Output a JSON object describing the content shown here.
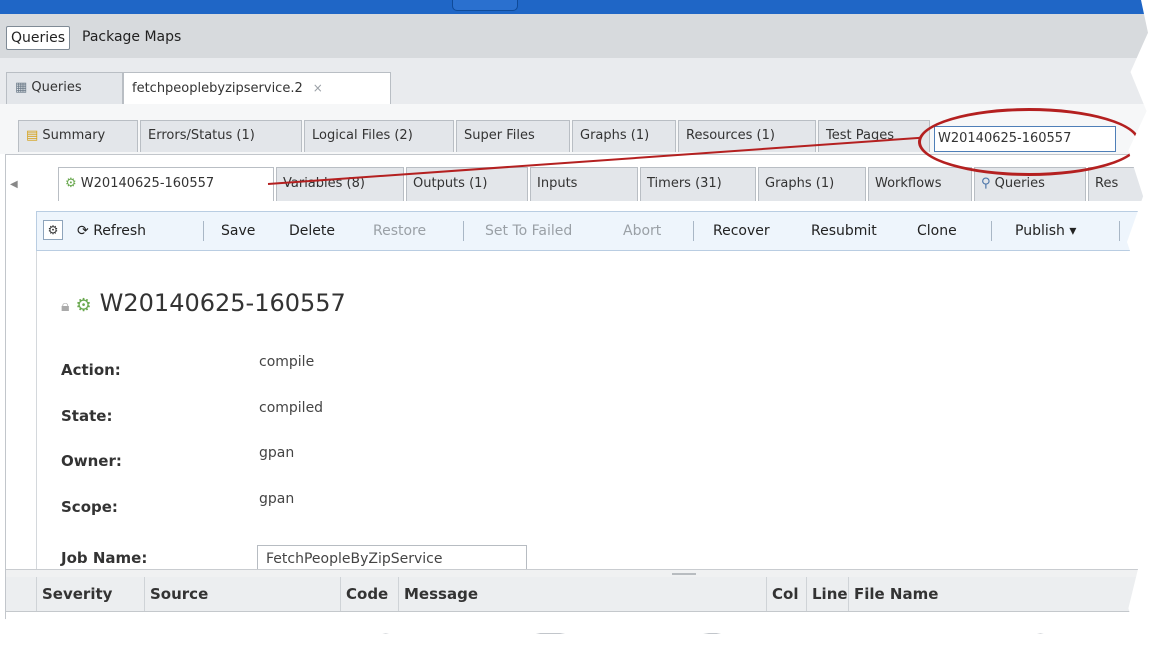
{
  "top_nav": {
    "queries": "Queries",
    "package_maps": "Package Maps"
  },
  "doc_tabs": {
    "queries": "Queries",
    "current": "fetchpeoplebyzipservice.2",
    "close": "×"
  },
  "query_tabs": [
    "Summary",
    "Errors/Status (1)",
    "Logical Files (2)",
    "Super Files",
    "Graphs (1)",
    "Resources (1)",
    "Test Pages"
  ],
  "highlighted_tab_value": "W20140625-160557",
  "wu_tabs": [
    "W20140625-160557",
    "Variables (8)",
    "Outputs (1)",
    "Inputs",
    "Timers (31)",
    "Graphs (1)",
    "Workflows",
    "Queries",
    "Res"
  ],
  "toolbar": {
    "refresh": "Refresh",
    "save": "Save",
    "delete": "Delete",
    "restore": "Restore",
    "set_to_failed": "Set To Failed",
    "abort": "Abort",
    "recover": "Recover",
    "resubmit": "Resubmit",
    "clone": "Clone",
    "publish": "Publish ▾"
  },
  "workunit": {
    "title": "W20140625-160557",
    "fields": [
      {
        "label": "Action:",
        "value": "compile"
      },
      {
        "label": "State:",
        "value": "compiled"
      },
      {
        "label": "Owner:",
        "value": "gpan"
      },
      {
        "label": "Scope:",
        "value": "gpan"
      },
      {
        "label": "Job Name:",
        "value": "FetchPeopleByZipService"
      }
    ]
  },
  "grid_columns": [
    "Severity",
    "Source",
    "Code",
    "Message",
    "Col",
    "Line",
    "File Name"
  ],
  "colors": {
    "accent": "#1f66c6",
    "callout": "#b42020",
    "toolbar_bg": "#eef5fc"
  },
  "icons": [
    "table-icon",
    "summary-icon",
    "gear-icon",
    "refresh-icon",
    "search-icon",
    "lock-icon",
    "chevron-left-icon"
  ]
}
